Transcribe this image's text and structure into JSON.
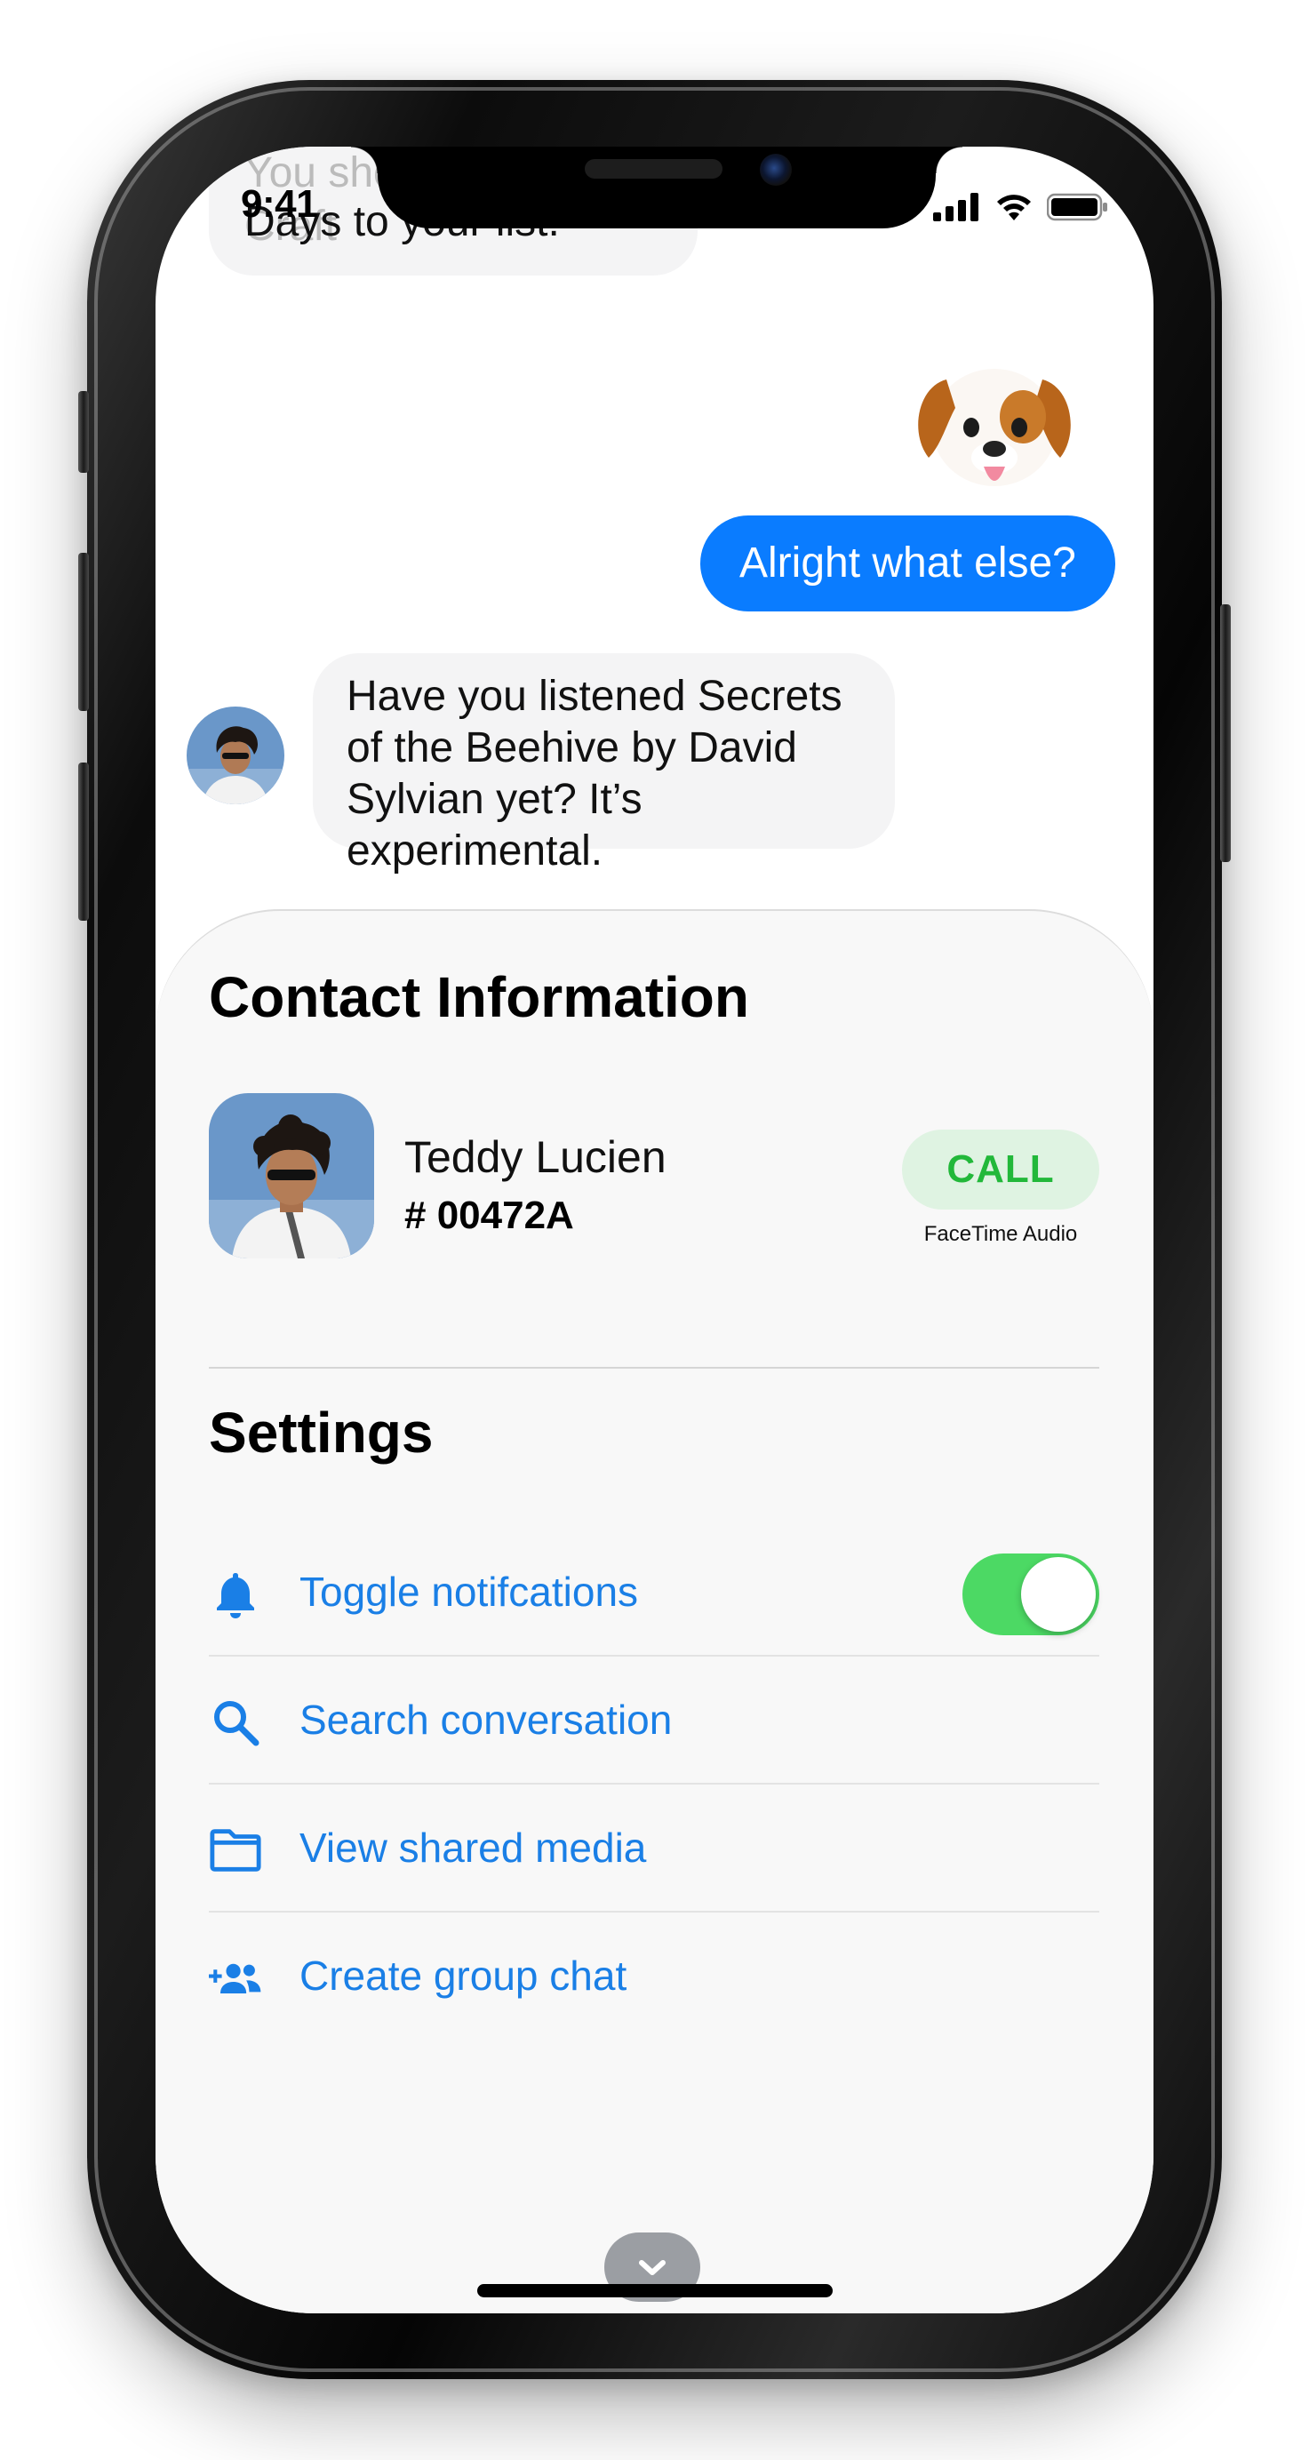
{
  "status_bar": {
    "time": "9:41",
    "icons": [
      "signal-bars-icon",
      "wifi-icon",
      "battery-icon"
    ]
  },
  "messages": [
    {
      "sender": "contact",
      "text_line_1": "You should add New Craft",
      "text_line_2": "Days to your list."
    },
    {
      "sender": "me",
      "type": "emoji",
      "icon": "dog-face-emoji"
    },
    {
      "sender": "me",
      "text": "Alright what else?"
    },
    {
      "sender": "contact",
      "text": "Have you listened Secrets of the Beehive by David Sylvian yet? It’s experimental."
    }
  ],
  "contact": {
    "section_title": "Contact Information",
    "name": "Teddy Lucien",
    "id": "# 00472A",
    "call_label": "CALL",
    "call_sublabel": "FaceTime Audio"
  },
  "settings": {
    "section_title": "Settings",
    "items": [
      {
        "label": "Toggle notifcations",
        "icon": "bell-icon",
        "toggle_on": true
      },
      {
        "label": "Search conversation",
        "icon": "search-icon"
      },
      {
        "label": "View shared media",
        "icon": "folder-icon"
      },
      {
        "label": "Create group chat",
        "icon": "add-group-icon"
      }
    ]
  },
  "colors": {
    "accent_blue": "#0a7cff",
    "link_blue": "#1a7fe6",
    "call_green": "#22b83a",
    "toggle_green": "#4cd964"
  }
}
